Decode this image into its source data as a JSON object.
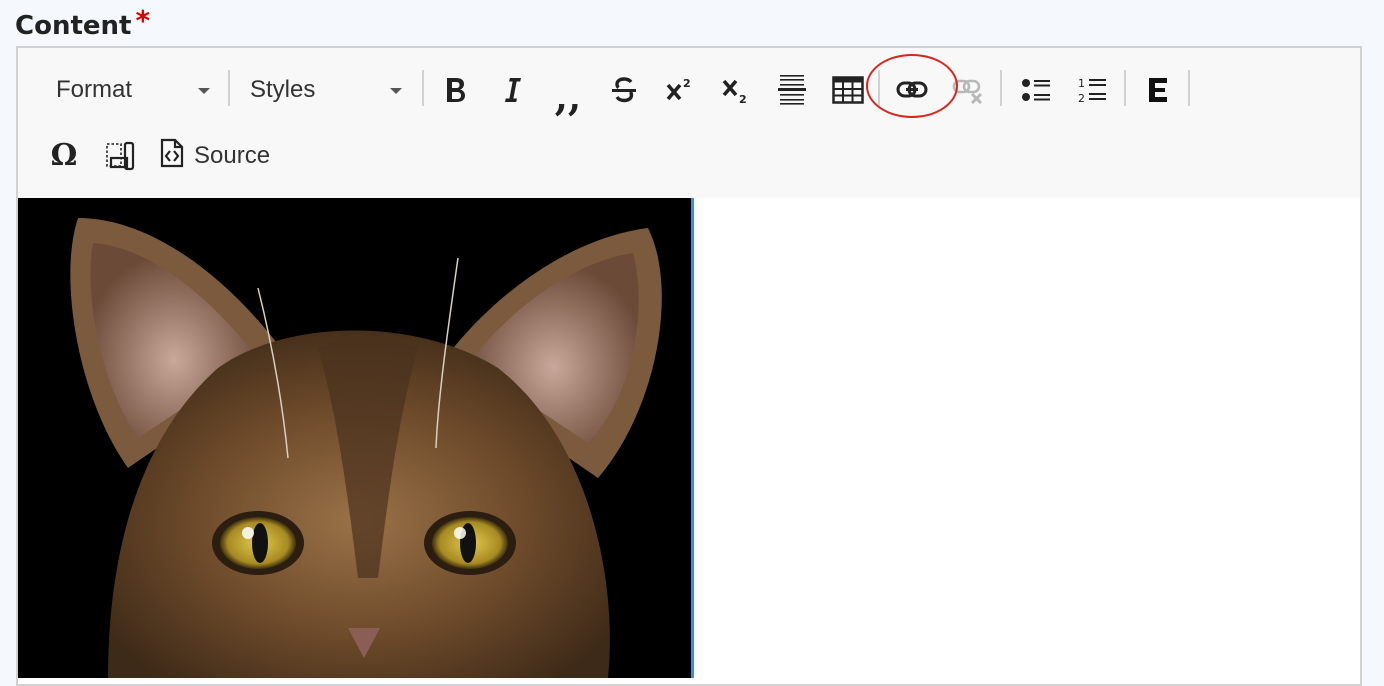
{
  "field": {
    "label": "Content",
    "required_marker": "*"
  },
  "toolbar": {
    "format_label": "Format",
    "styles_label": "Styles",
    "buttons": [
      {
        "name": "bold",
        "icon": "bold-icon"
      },
      {
        "name": "italic",
        "icon": "italic-icon"
      },
      {
        "name": "blockquote",
        "icon": "blockquote-icon"
      },
      {
        "name": "strikethrough",
        "icon": "strikethrough-icon"
      },
      {
        "name": "superscript",
        "icon": "superscript-icon"
      },
      {
        "name": "subscript",
        "icon": "subscript-icon"
      },
      {
        "name": "horizontal-line",
        "icon": "horizontal-line-icon"
      },
      {
        "name": "table",
        "icon": "table-icon"
      },
      {
        "name": "link",
        "icon": "link-icon",
        "highlighted": true
      },
      {
        "name": "unlink",
        "icon": "unlink-icon",
        "disabled": true
      },
      {
        "name": "bulleted-list",
        "icon": "bulleted-list-icon"
      },
      {
        "name": "numbered-list",
        "icon": "numbered-list-icon"
      },
      {
        "name": "entity-embed",
        "icon": "entity-embed-icon"
      },
      {
        "name": "special-character",
        "icon": "omega-icon"
      },
      {
        "name": "show-blocks",
        "icon": "show-blocks-icon"
      }
    ],
    "source_label": "Source"
  },
  "colors": {
    "required": "#e00000",
    "highlight_ring": "#d9261c",
    "selection": "#3c90d8",
    "toolbar_bg": "#f8f8f8"
  }
}
